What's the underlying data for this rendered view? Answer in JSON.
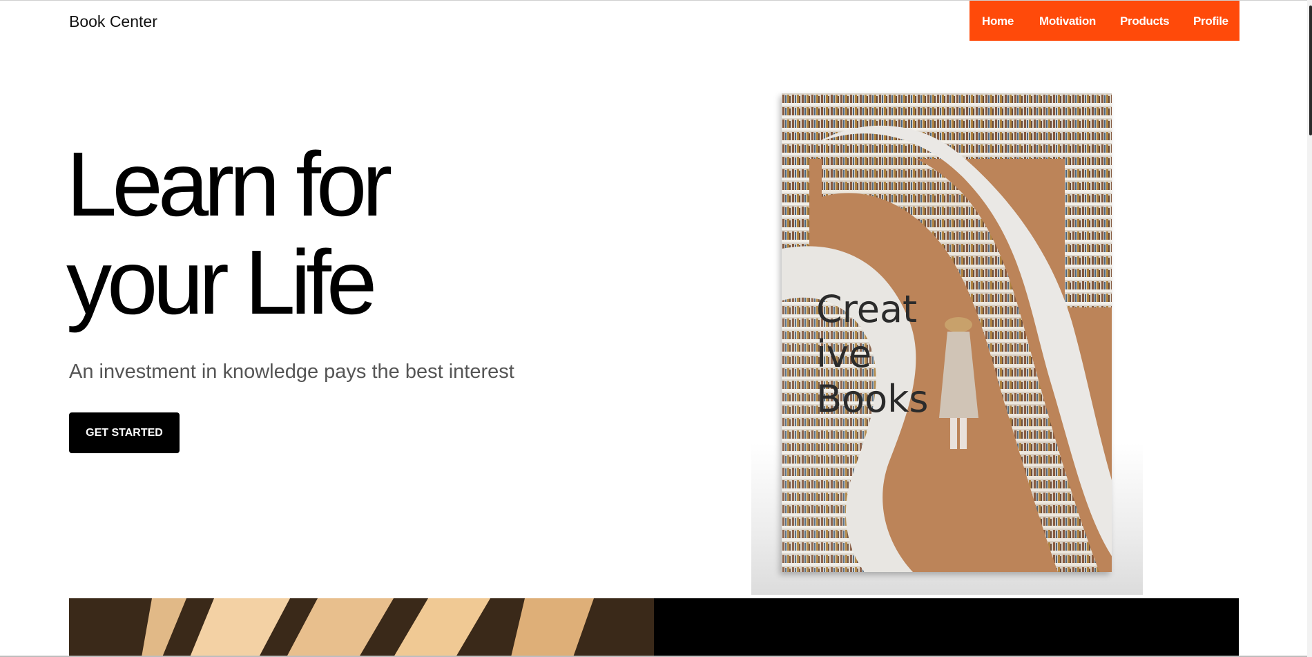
{
  "header": {
    "brand": "Book Center",
    "nav": [
      "Home",
      "Motivation",
      "Products",
      "Profile"
    ],
    "nav_color": "#ff4a0a"
  },
  "hero": {
    "title_line1": "Learn for",
    "title_line2": "your Life",
    "subtitle": "An investment in knowledge pays the best interest",
    "cta": "GET STARTED"
  },
  "book": {
    "line1": "Creat",
    "line2": "ive",
    "line3": "Books"
  }
}
